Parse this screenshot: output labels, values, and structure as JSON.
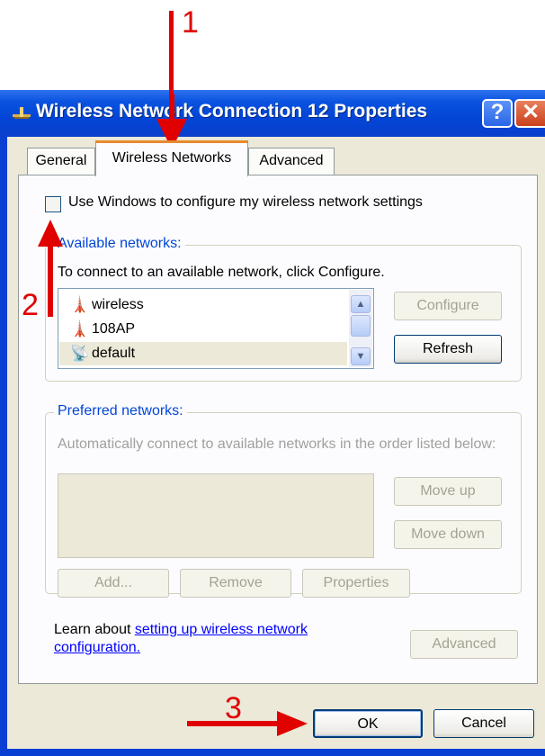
{
  "annotations": {
    "step1": "1",
    "step2": "2",
    "step3": "3"
  },
  "window": {
    "title": "Wireless Network Connection 12 Properties",
    "help_glyph": "?",
    "close_glyph": "✕"
  },
  "tabs": [
    {
      "label": "General"
    },
    {
      "label": "Wireless Networks",
      "active": true
    },
    {
      "label": "Advanced"
    }
  ],
  "use_windows_checkbox": {
    "label": "Use Windows to configure my wireless network settings",
    "checked": false
  },
  "available_networks": {
    "title": "Available networks:",
    "description": "To connect to an available network, click Configure.",
    "items": [
      {
        "name": "wireless",
        "icon": "antenna-icon"
      },
      {
        "name": "108AP",
        "icon": "antenna-icon"
      },
      {
        "name": "default",
        "icon": "wireless-beacon-icon",
        "selected": true
      }
    ],
    "configure_label": "Configure",
    "refresh_label": "Refresh"
  },
  "preferred_networks": {
    "title": "Preferred networks:",
    "description": "Automatically connect to available networks in the order listed below:",
    "move_up_label": "Move up",
    "move_down_label": "Move down",
    "add_label": "Add...",
    "remove_label": "Remove",
    "properties_label": "Properties"
  },
  "learn": {
    "prefix": "Learn about ",
    "link_text": "setting up wireless network configuration."
  },
  "advanced_label": "Advanced",
  "ok_label": "OK",
  "cancel_label": "Cancel",
  "colors": {
    "annotation": "#e00000",
    "titlebar": "#0245d6",
    "tab_highlight": "#e68b2c",
    "group_title": "#0046d5"
  }
}
